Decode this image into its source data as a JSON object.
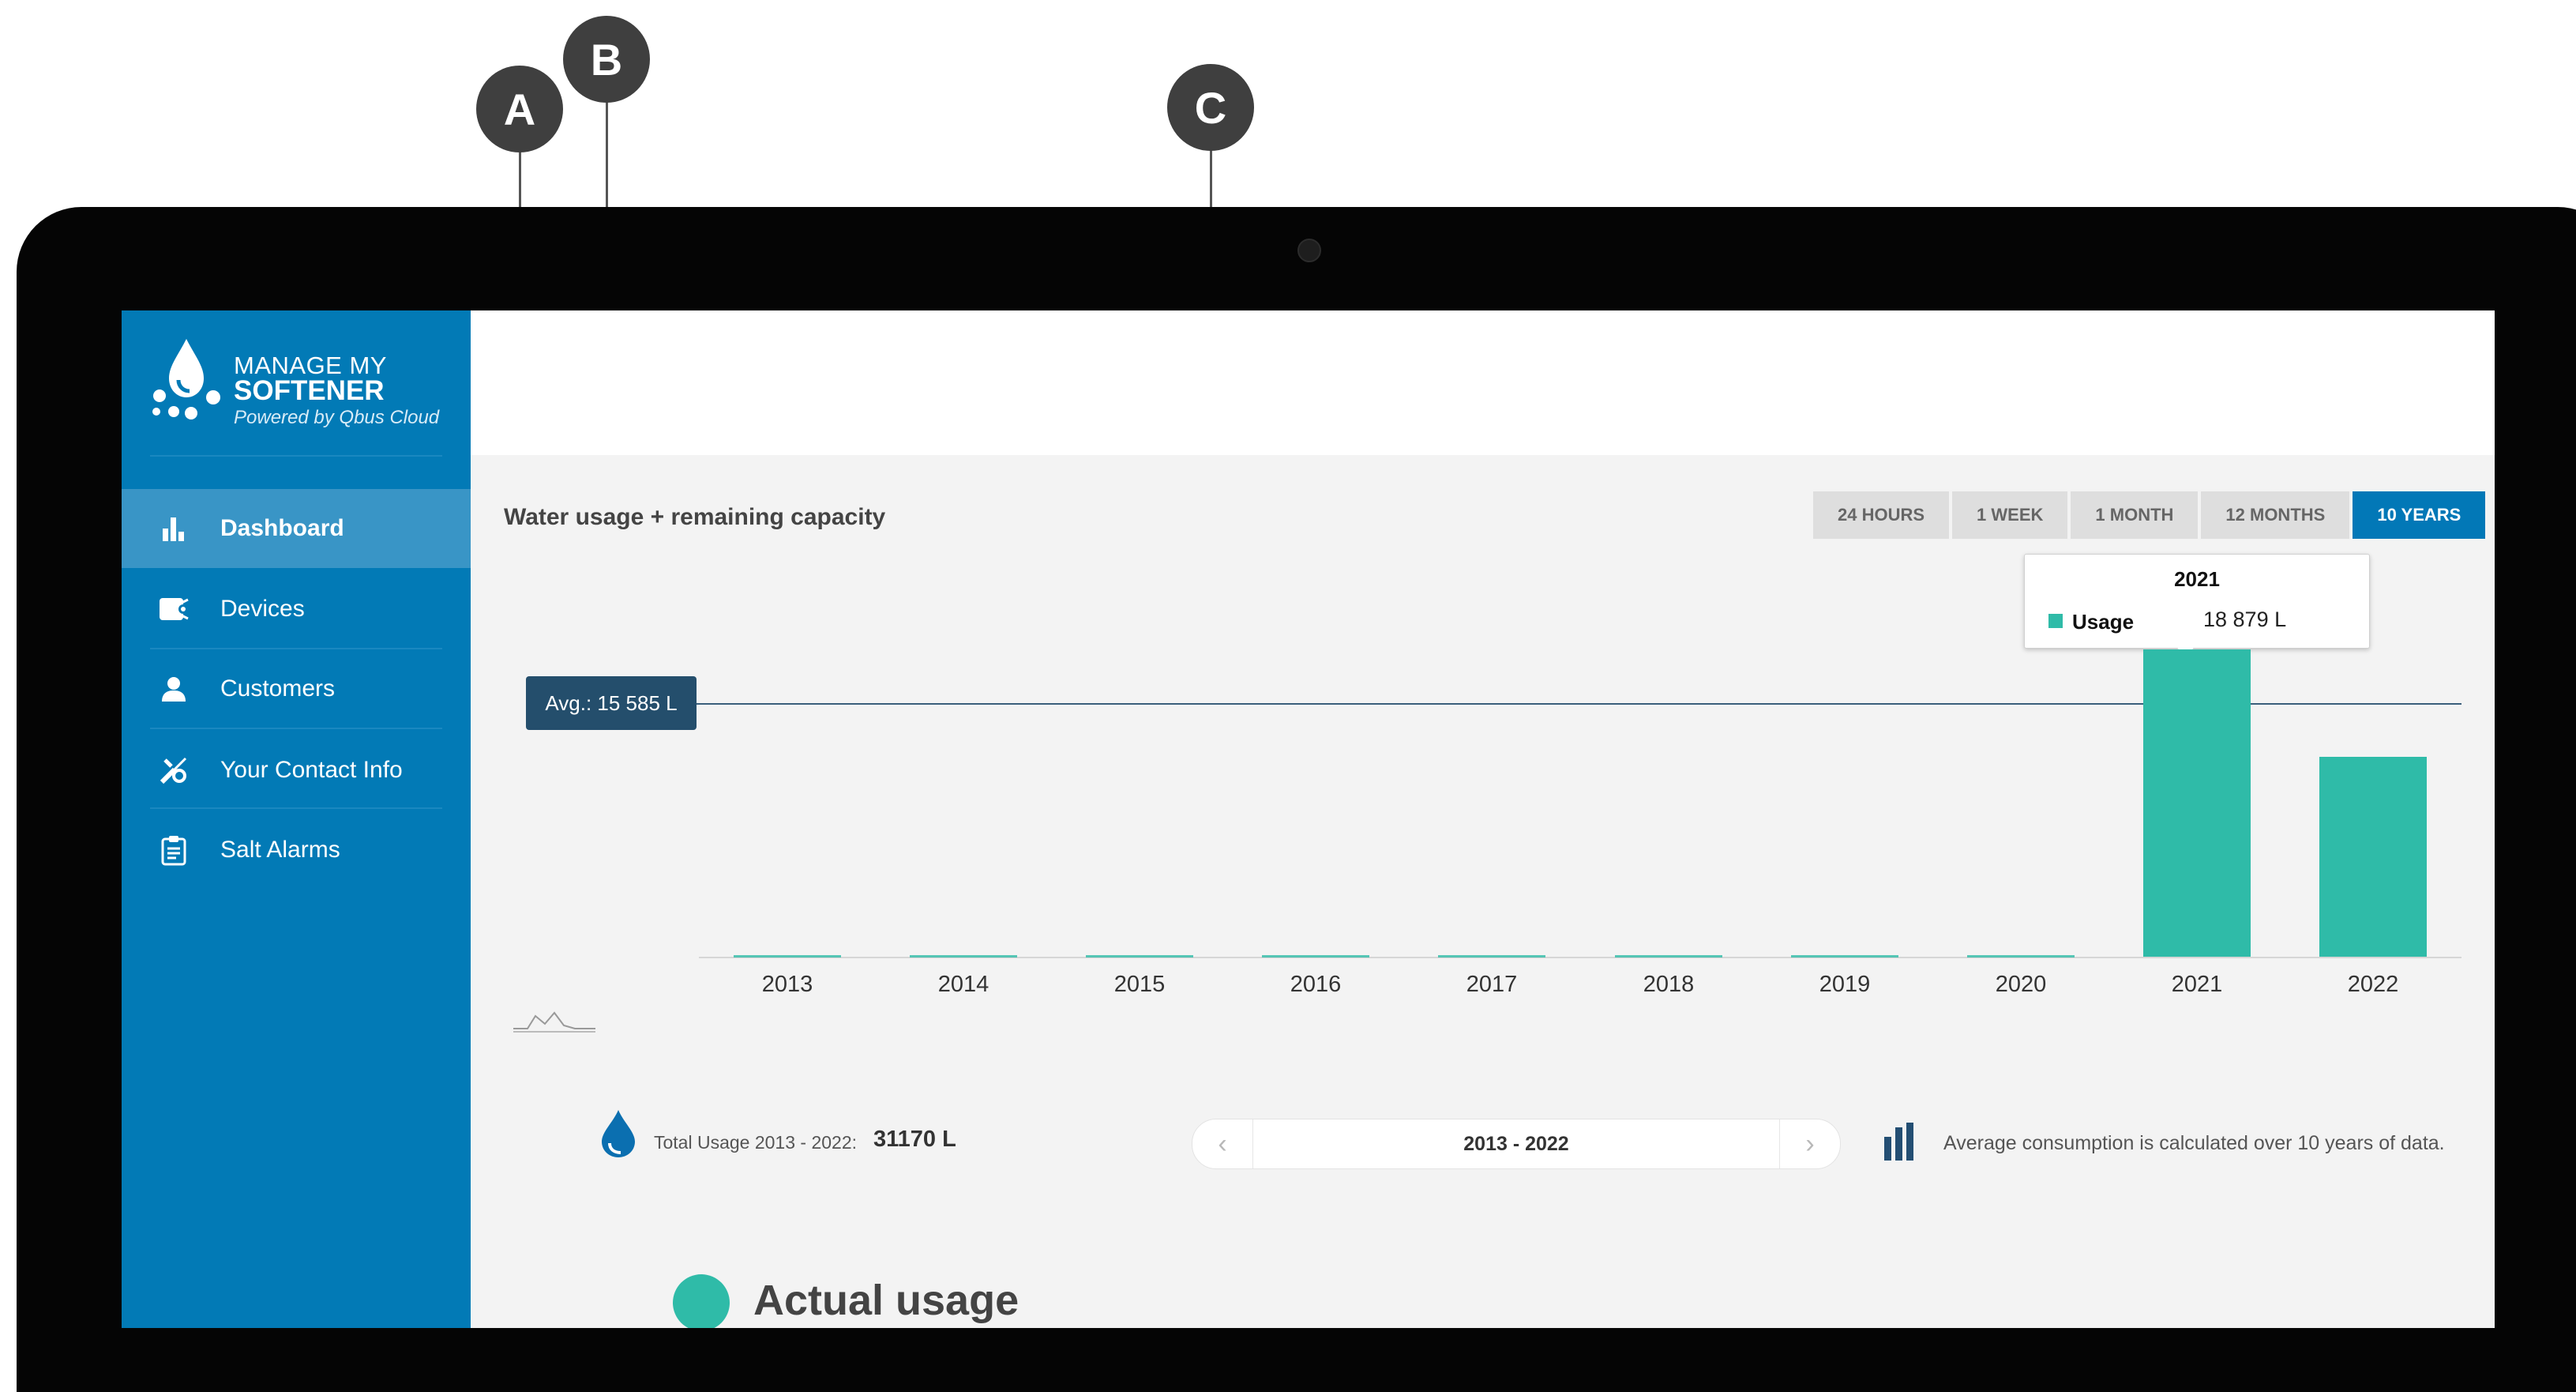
{
  "app": {
    "logo_line1": "MANAGE MY",
    "logo_line2": "SOFTENER",
    "logo_line3": "Powered by Qbus Cloud"
  },
  "sidebar": {
    "items": [
      {
        "label": "Dashboard",
        "icon": "bar-chart-icon",
        "active": true
      },
      {
        "label": "Devices",
        "icon": "device-icon",
        "active": false
      },
      {
        "label": "Customers",
        "icon": "user-icon",
        "active": false
      },
      {
        "label": "Your Contact Info",
        "icon": "tools-icon",
        "active": false
      },
      {
        "label": "Salt Alarms",
        "icon": "clipboard-icon",
        "active": false
      }
    ]
  },
  "chart": {
    "title": "Water usage + remaining capacity",
    "ranges": [
      "24 HOURS",
      "1 WEEK",
      "1 MONTH",
      "12 MONTHS",
      "10 YEARS"
    ],
    "active_range": "10 YEARS",
    "avg_label": "Avg.: 15 585 L",
    "tooltip": {
      "title": "2021",
      "series": "Usage",
      "value": "18 879 L"
    }
  },
  "chart_data": {
    "type": "bar",
    "categories": [
      "2013",
      "2014",
      "2015",
      "2016",
      "2017",
      "2018",
      "2019",
      "2020",
      "2021",
      "2022"
    ],
    "series": [
      {
        "name": "Usage",
        "values": [
          0,
          0,
          0,
          0,
          0,
          0,
          0,
          0,
          18879,
          12291
        ]
      }
    ],
    "average": 15585,
    "unit": "L",
    "ylim": [
      0,
      19000
    ],
    "grid": false,
    "color": "#2fbba8"
  },
  "summary": {
    "total_label": "Total Usage 2013 - 2022:",
    "total_value": "31170 L",
    "period": "2013 - 2022",
    "prev": "‹",
    "next": "›",
    "avg_note": "Average consumption is calculated over 10 years of data."
  },
  "legend": {
    "label": "Actual usage"
  },
  "callouts": [
    "A",
    "B",
    "C"
  ],
  "colors": {
    "sidebar": "#027ab6",
    "accent": "#0278b7",
    "bar": "#2fbba8",
    "avg": "#244e6c"
  }
}
